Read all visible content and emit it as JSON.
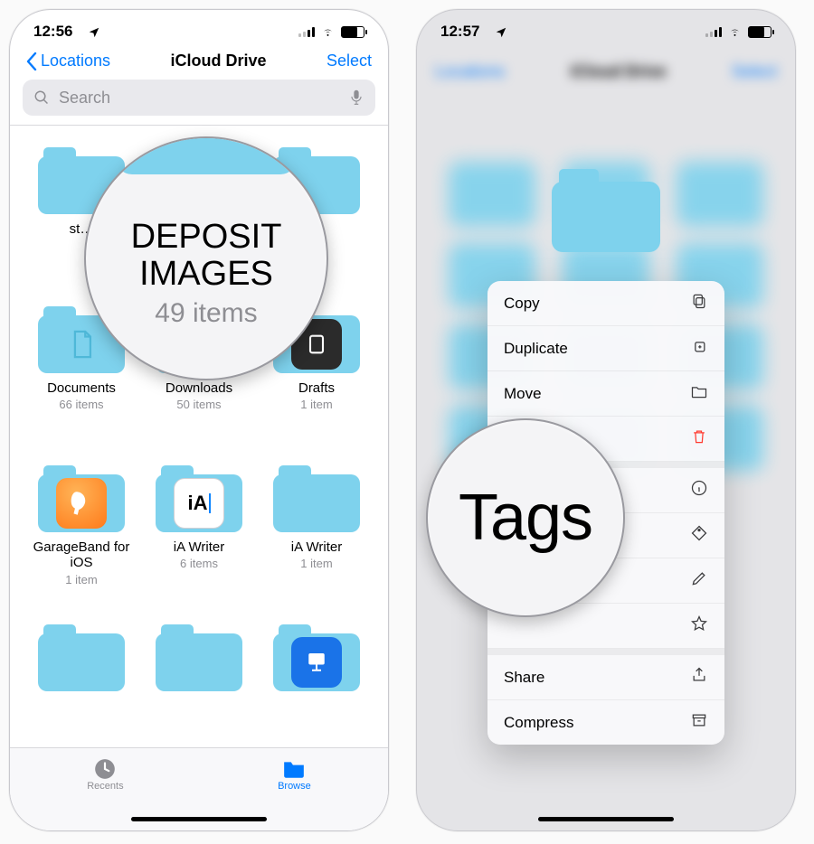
{
  "left": {
    "status": {
      "time": "12:56"
    },
    "nav": {
      "back": "Locations",
      "title": "iCloud Drive",
      "action": "Select"
    },
    "search": {
      "placeholder": "Search"
    },
    "folders": [
      {
        "name": "st…",
        "sub": "",
        "icon": "plain"
      },
      {
        "name": "",
        "sub": "",
        "icon": "plain"
      },
      {
        "name": "",
        "sub": "",
        "icon": "plain"
      },
      {
        "name": "Documents",
        "sub": "66 items",
        "icon": "doc"
      },
      {
        "name": "Downloads",
        "sub": "50 items",
        "icon": "download"
      },
      {
        "name": "Drafts",
        "sub": "1 item",
        "icon": "drafts"
      },
      {
        "name": "GarageBand for iOS",
        "sub": "1 item",
        "icon": "gb"
      },
      {
        "name": "iA Writer",
        "sub": "6 items",
        "icon": "ia"
      },
      {
        "name": "iA Writer",
        "sub": "1 item",
        "icon": "plain"
      },
      {
        "name": "",
        "sub": "",
        "icon": "plain"
      },
      {
        "name": "",
        "sub": "",
        "icon": "plain"
      },
      {
        "name": "",
        "sub": "",
        "icon": "keynote"
      }
    ],
    "tabs": {
      "recents": "Recents",
      "browse": "Browse"
    },
    "callout": {
      "line1": "DEPOSIT",
      "line2": "IMAGES",
      "sub": "49 items"
    }
  },
  "right": {
    "status": {
      "time": "12:57"
    },
    "menu": [
      {
        "label": "Copy",
        "icon": "copy"
      },
      {
        "label": "Duplicate",
        "icon": "duplicate"
      },
      {
        "label": "Move",
        "icon": "folder"
      },
      {
        "label": "",
        "icon": "trash",
        "danger": true
      },
      {
        "label": "",
        "icon": "info"
      },
      {
        "label": "",
        "icon": "tag"
      },
      {
        "label": "",
        "icon": "pencil"
      },
      {
        "label": "",
        "icon": "star"
      },
      {
        "label": "Share",
        "icon": "share"
      },
      {
        "label": "Compress",
        "icon": "archive"
      }
    ],
    "callout": "Tags"
  }
}
